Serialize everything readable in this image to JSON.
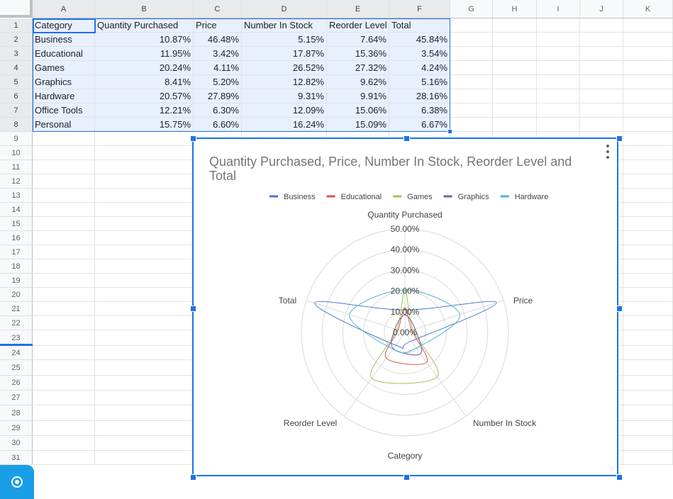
{
  "sheet": {
    "columns": [
      "A",
      "B",
      "C",
      "D",
      "E",
      "F",
      "G",
      "H",
      "I",
      "J",
      "K"
    ],
    "rows": [
      "1",
      "2",
      "3",
      "4",
      "5",
      "6",
      "7",
      "8",
      "9",
      "10",
      "11",
      "12",
      "13",
      "14",
      "15",
      "16",
      "17",
      "18",
      "19",
      "20",
      "21",
      "22",
      "23",
      "24",
      "25",
      "26",
      "27",
      "28",
      "29",
      "30",
      "31"
    ],
    "header_row": [
      "Category",
      "Quantity Purchased",
      "Price",
      "Number In Stock",
      "Reorder Level",
      "Total"
    ],
    "data_rows": [
      [
        "Business",
        "10.87%",
        "46.48%",
        "5.15%",
        "7.64%",
        "45.84%"
      ],
      [
        "Educational",
        "11.95%",
        "3.42%",
        "17.87%",
        "15.36%",
        "3.54%"
      ],
      [
        "Games",
        "20.24%",
        "4.11%",
        "26.52%",
        "27.32%",
        "4.24%"
      ],
      [
        "Graphics",
        "8.41%",
        "5.20%",
        "12.82%",
        "9.62%",
        "5.16%"
      ],
      [
        "Hardware",
        "20.57%",
        "27.89%",
        "9.31%",
        "9.91%",
        "28.16%"
      ],
      [
        "Office Tools",
        "12.21%",
        "6.30%",
        "12.09%",
        "15.06%",
        "6.38%"
      ],
      [
        "Personal",
        "15.75%",
        "6.60%",
        "16.24%",
        "15.09%",
        "6.67%"
      ]
    ]
  },
  "chart": {
    "menu_icon": "more-vert-icon"
  },
  "chart_data": {
    "type": "radar",
    "title": "Quantity Purchased, Price, Number In Stock, Reorder Level and Total",
    "axes": [
      "Quantity Purchased",
      "Price",
      "Number In Stock",
      "Reorder Level",
      "Total"
    ],
    "xlabel": "Category",
    "rlim": [
      0,
      50
    ],
    "ticks": [
      "0.00%",
      "10.00%",
      "20.00%",
      "30.00%",
      "40.00%",
      "50.00%"
    ],
    "grid": true,
    "legend_position": "top",
    "series": [
      {
        "name": "Business",
        "color": "#4a7bcb",
        "values": [
          10.87,
          46.48,
          5.15,
          7.64,
          45.84
        ]
      },
      {
        "name": "Educational",
        "color": "#d9534f",
        "values": [
          11.95,
          3.42,
          17.87,
          15.36,
          3.54
        ]
      },
      {
        "name": "Games",
        "color": "#9bc55a",
        "values": [
          20.24,
          4.11,
          26.52,
          27.32,
          4.24
        ]
      },
      {
        "name": "Graphics",
        "color": "#7d5ba6",
        "values": [
          8.41,
          5.2,
          12.82,
          9.62,
          5.16
        ]
      },
      {
        "name": "Hardware",
        "color": "#4fb3cf",
        "values": [
          20.57,
          27.89,
          9.31,
          9.91,
          28.16
        ]
      }
    ]
  },
  "fab": {
    "icon": "record-icon"
  }
}
